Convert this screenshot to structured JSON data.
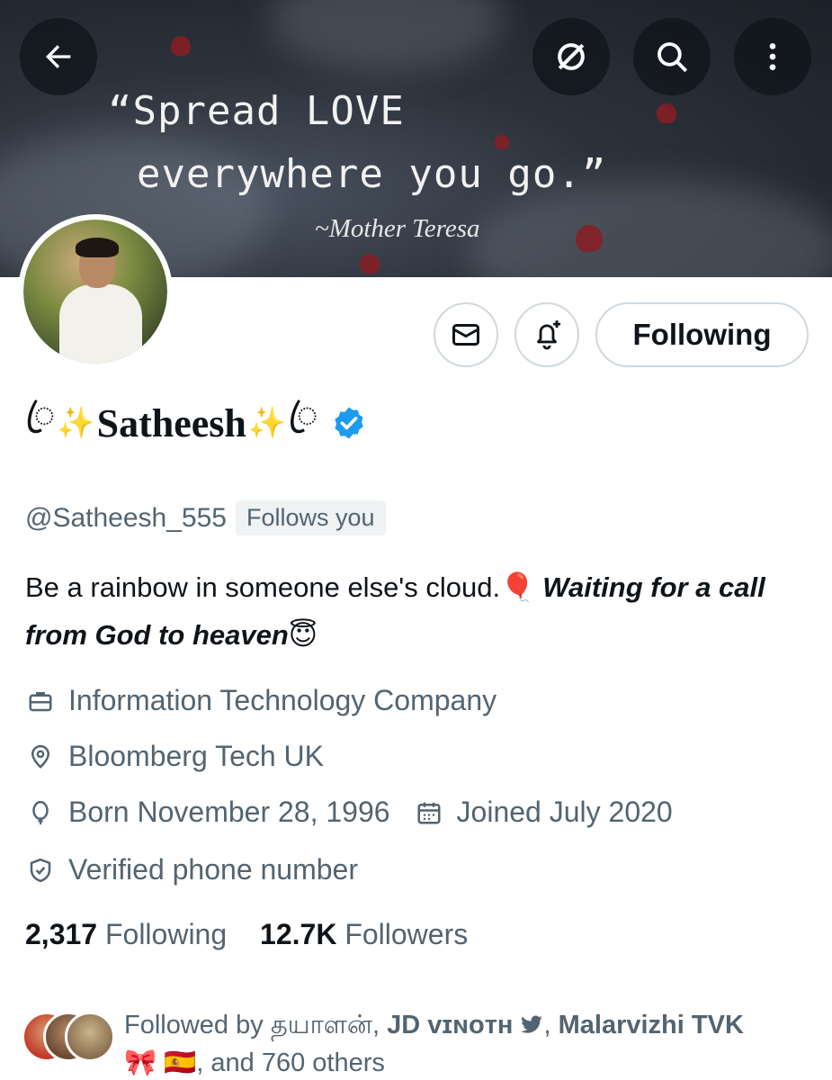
{
  "header": {
    "banner_quote_line1": "“Spread LOVE",
    "banner_quote_line2": "everywhere you go.”",
    "banner_author": "~Mother Teresa",
    "back_icon": "arrow-left-icon",
    "grok_icon": "grok-slash-icon",
    "search_icon": "search-icon",
    "more_icon": "more-vertical-icon"
  },
  "actions": {
    "message_icon": "envelope-icon",
    "notify_icon": "bell-plus-icon",
    "following_label": "Following"
  },
  "profile": {
    "name_prefix": "ꦿ✨",
    "name": "Satheesh",
    "name_suffix": "✨ꦿ",
    "verified": true,
    "handle": "@Satheesh_555",
    "follows_you": "Follows you",
    "bio_plain": "Be a rainbow in someone else's cloud.🎈 ",
    "bio_bold_italic": "Waiting for a call from God to heaven😇",
    "category": "Information Technology Company",
    "location": "Bloomberg Tech UK",
    "born": "Born November 28, 1996",
    "joined": "Joined July 2020",
    "verified_phone": "Verified phone number"
  },
  "stats": {
    "following_count": "2,317",
    "following_label": "Following",
    "followers_count": "12.7K",
    "followers_label": "Followers"
  },
  "followed_by": {
    "prefix": "Followed by ",
    "name1": "தயாளன்",
    "sep1": ", ",
    "name2": "JD ᴠɪɴᴏᴛʜ",
    "name2_icon": "🐦",
    "sep2": ", ",
    "name3": "Malarvizhi TVK",
    "name3_emoji": "🎀 🇪🇸",
    "suffix": ", and 760 others"
  },
  "colors": {
    "accent": "#1d9bf0",
    "text_primary": "#0f1419",
    "text_secondary": "#536471",
    "border": "#cfd9de"
  }
}
